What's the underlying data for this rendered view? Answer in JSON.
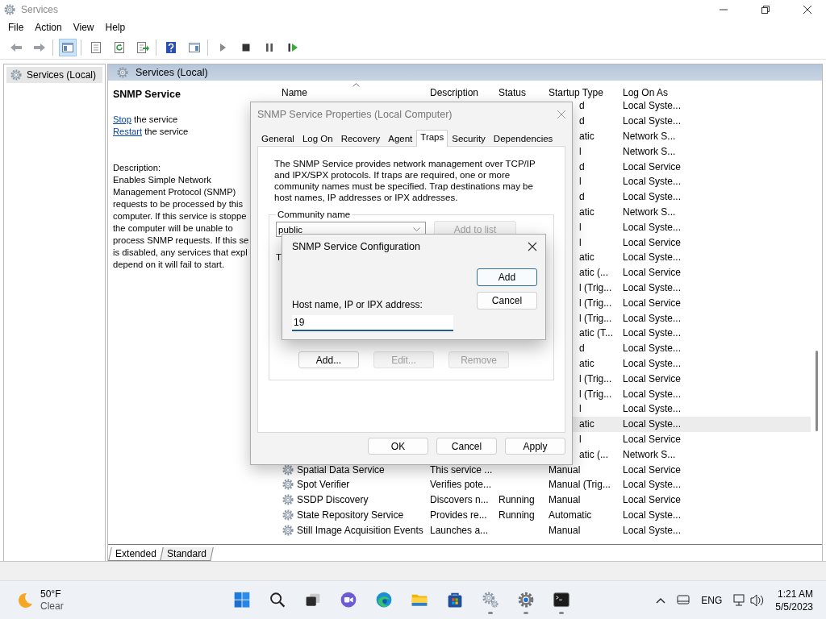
{
  "window": {
    "title": "Services"
  },
  "menu": [
    "File",
    "Action",
    "View",
    "Help"
  ],
  "toolbar": [
    [
      {
        "kind": "back",
        "selected": false
      },
      {
        "kind": "forward",
        "selected": false
      }
    ],
    [
      {
        "kind": "console-tree",
        "selected": true
      }
    ],
    [
      {
        "kind": "properties",
        "selected": false
      },
      {
        "kind": "refresh",
        "selected": false
      },
      {
        "kind": "export",
        "selected": false
      }
    ],
    [
      {
        "kind": "help",
        "selected": false
      },
      {
        "kind": "action-pane",
        "selected": false
      }
    ],
    [
      {
        "kind": "start",
        "selected": false
      },
      {
        "kind": "stop",
        "selected": false
      },
      {
        "kind": "pause",
        "selected": false
      },
      {
        "kind": "resume",
        "selected": false
      }
    ]
  ],
  "tree": [
    {
      "label": "Services (Local)",
      "selected": true
    }
  ],
  "pane_header": "Services (Local)",
  "details": {
    "title": "SNMP Service",
    "actions": [
      {
        "link": "Stop",
        "text": " the service"
      },
      {
        "link": "Restart",
        "text": " the service"
      }
    ],
    "description_label": "Description:",
    "description_lines": [
      "Enables Simple Network",
      "Management Protocol (SNMP)",
      "requests to be processed by this",
      "computer. If this service is stoppe",
      "the computer will be unable to",
      "process SNMP requests. If this se",
      "is disabled, any services that expl",
      "depend on it will fail to start."
    ]
  },
  "list": {
    "columns": [
      "Name",
      "Description",
      "Status",
      "Startup Type",
      "Log On As"
    ],
    "rows": [
      {
        "startup_type": "d",
        "log_on_as": "Local Syste...",
        "selected": false
      },
      {
        "startup_type": "d",
        "log_on_as": "Local Syste...",
        "selected": false
      },
      {
        "startup_type": "atic",
        "log_on_as": "Network S...",
        "selected": false
      },
      {
        "startup_type": "l",
        "log_on_as": "Network S...",
        "selected": false
      },
      {
        "startup_type": "d",
        "log_on_as": "Local Service",
        "selected": false
      },
      {
        "startup_type": "l",
        "log_on_as": "Local Syste...",
        "selected": false
      },
      {
        "startup_type": "d",
        "log_on_as": "Local Syste...",
        "selected": false
      },
      {
        "startup_type": "atic",
        "log_on_as": "Network S...",
        "selected": false
      },
      {
        "startup_type": "l",
        "log_on_as": "Local Syste...",
        "selected": false
      },
      {
        "startup_type": "l",
        "log_on_as": "Local Service",
        "selected": false
      },
      {
        "startup_type": "atic",
        "log_on_as": "Local Syste...",
        "selected": false
      },
      {
        "startup_type": "atic (...",
        "log_on_as": "Local Service",
        "selected": false
      },
      {
        "startup_type": "l (Trig...",
        "log_on_as": "Local Syste...",
        "selected": false
      },
      {
        "startup_type": "l (Trig...",
        "log_on_as": "Local Service",
        "selected": false
      },
      {
        "startup_type": "l (Trig...",
        "log_on_as": "Local Syste...",
        "selected": false
      },
      {
        "startup_type": "atic (T...",
        "log_on_as": "Local Syste...",
        "selected": false
      },
      {
        "startup_type": "d",
        "log_on_as": "Local Syste...",
        "selected": false
      },
      {
        "startup_type": "atic",
        "log_on_as": "Local Syste...",
        "selected": false
      },
      {
        "startup_type": "l (Trig...",
        "log_on_as": "Local Service",
        "selected": false
      },
      {
        "startup_type": "l (Trig...",
        "log_on_as": "Local Syste...",
        "selected": false
      },
      {
        "startup_type": "l",
        "log_on_as": "Local Syste...",
        "selected": false
      },
      {
        "startup_type": "atic",
        "log_on_as": "Local Syste...",
        "selected": true
      },
      {
        "startup_type": "l",
        "log_on_as": "Local Service",
        "selected": false
      },
      {
        "startup_type": "atic (...",
        "log_on_as": "Network S...",
        "selected": false
      },
      {
        "name": "Spatial Data Service",
        "description": "This service ...",
        "startup_type": "Manual",
        "log_on_as": "Local Service",
        "selected": false
      },
      {
        "name": "Spot Verifier",
        "description": "Verifies pote...",
        "startup_type": "Manual (Trig...",
        "log_on_as": "Local Syste...",
        "selected": false
      },
      {
        "name": "SSDP Discovery",
        "description": "Discovers n...",
        "status": "Running",
        "startup_type": "Manual",
        "log_on_as": "Local Service",
        "selected": false
      },
      {
        "name": "State Repository Service",
        "description": "Provides re...",
        "status": "Running",
        "startup_type": "Automatic",
        "log_on_as": "Local Syste...",
        "selected": false
      },
      {
        "name": "Still Image Acquisition Events",
        "description": "Launches a...",
        "startup_type": "Manual",
        "log_on_as": "Local Syste...",
        "selected": false
      }
    ]
  },
  "view_tabs": [
    {
      "label": "Extended",
      "selected": true
    },
    {
      "label": "Standard",
      "selected": false
    }
  ],
  "properties_dialog": {
    "title": "SNMP Service Properties (Local Computer)",
    "tabs": [
      {
        "label": "General",
        "selected": false
      },
      {
        "label": "Log On",
        "selected": false
      },
      {
        "label": "Recovery",
        "selected": false
      },
      {
        "label": "Agent",
        "selected": false
      },
      {
        "label": "Traps",
        "selected": true
      },
      {
        "label": "Security",
        "selected": false
      },
      {
        "label": "Dependencies",
        "selected": false
      }
    ],
    "intro": "The SNMP Service provides network management over TCP/IP and IPX/SPX protocols. If traps are required, one or more community names must be specified. Trap destinations may be host names, IP addresses or IPX addresses.",
    "community_label": "Community name",
    "community_value": "public",
    "add_to_list": {
      "label": "Add to list",
      "disabled": true
    },
    "destinations_label": "T",
    "destination_buttons": [
      {
        "label": "Add...",
        "disabled": false
      },
      {
        "label": "Edit...",
        "disabled": true
      },
      {
        "label": "Remove",
        "disabled": true
      }
    ],
    "buttons": [
      {
        "label": "OK",
        "disabled": false
      },
      {
        "label": "Cancel",
        "disabled": false
      },
      {
        "label": "Apply",
        "disabled": false
      }
    ]
  },
  "config_dialog": {
    "title": "SNMP Service Configuration",
    "buttons": [
      {
        "label": "Add",
        "default": true
      },
      {
        "label": "Cancel",
        "default": false
      }
    ],
    "field_label": "Host name, IP or IPX address:",
    "field_value": "19",
    "focused": true
  },
  "taskbar": {
    "weather": {
      "temperature": "50°F",
      "condition": "Clear"
    },
    "apps": [
      {
        "kind": "start",
        "running": false
      },
      {
        "kind": "search",
        "running": false
      },
      {
        "kind": "task-view",
        "running": false
      },
      {
        "kind": "chat",
        "running": false
      },
      {
        "kind": "browser",
        "running": false
      },
      {
        "kind": "explorer",
        "running": false
      },
      {
        "kind": "store",
        "running": false
      },
      {
        "kind": "services",
        "running": true
      },
      {
        "kind": "settings",
        "running": true
      },
      {
        "kind": "terminal",
        "running": true
      }
    ],
    "tray": {
      "language": "ENG",
      "time": "1:21 AM",
      "date": "5/5/2023"
    }
  }
}
